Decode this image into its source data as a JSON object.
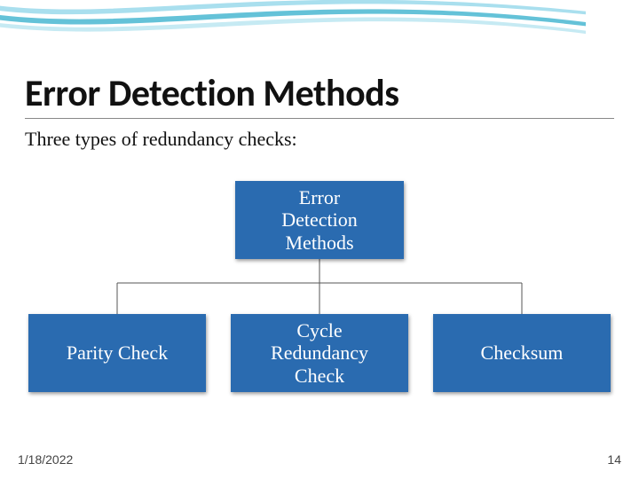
{
  "title": "Error Detection Methods",
  "subtitle": "Three types of redundancy checks:",
  "diagram": {
    "root": {
      "lines": [
        "Error",
        "Detection",
        "Methods"
      ]
    },
    "children": [
      {
        "lines": [
          "Parity Check"
        ]
      },
      {
        "lines": [
          "Cycle",
          "Redundancy",
          "Check"
        ]
      },
      {
        "lines": [
          "Checksum"
        ]
      }
    ]
  },
  "footer": {
    "date": "1/18/2022",
    "page": "14"
  },
  "colors": {
    "box_fill": "#2a6bb0",
    "swoosh_a": "#64c2d8",
    "swoosh_b": "#a9dfee"
  }
}
